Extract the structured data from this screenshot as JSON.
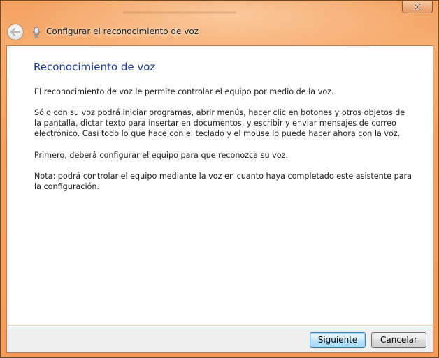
{
  "window": {
    "title": "Configurar el reconocimiento de voz"
  },
  "page": {
    "heading": "Reconocimiento de voz",
    "paragraphs": [
      "El reconocimiento de voz le permite controlar el equipo por medio de la voz.",
      "Sólo con su voz podrá iniciar programas, abrir menús, hacer clic en botones y otros objetos de la pantalla, dictar texto para insertar en documentos, y escribir y enviar mensajes de correo electrónico. Casi todo lo que hace con el teclado y el mouse lo puede hacer ahora con la voz.",
      "Primero, deberá configurar el equipo para que reconozca su voz.",
      "Nota: podrá controlar el equipo mediante la voz en cuanto haya completado este asistente para la configuración."
    ]
  },
  "buttons": {
    "next": "Siguiente",
    "cancel": "Cancelar"
  },
  "icons": {
    "back": "back-arrow-icon",
    "title": "microphone-icon",
    "close": "close-icon"
  },
  "colors": {
    "frame": "#f4a062",
    "heading": "#1e3f8e",
    "primary_border": "#3c7fb1"
  }
}
